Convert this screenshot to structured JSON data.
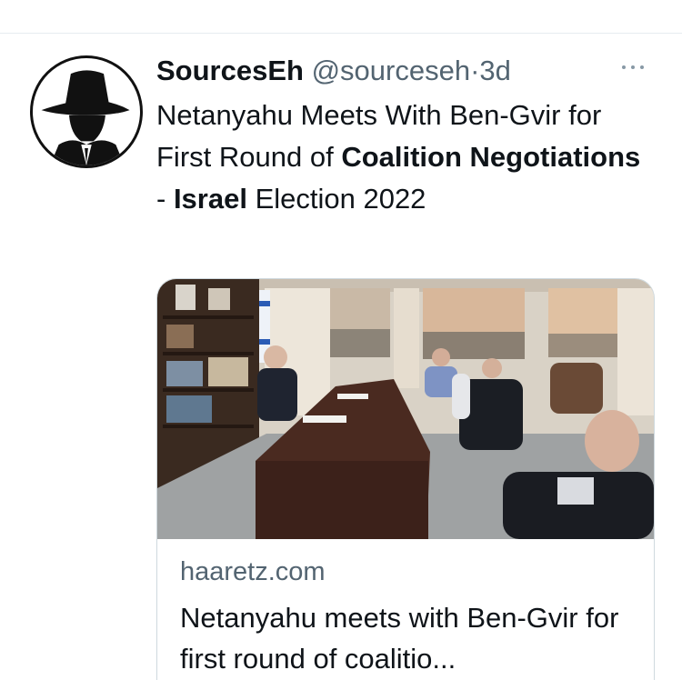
{
  "tweet": {
    "author_name": "SourcesEh",
    "author_handle": "@sourceseh",
    "separator": "·",
    "time": "3d",
    "text_parts": {
      "p1": "Netanyahu Meets With Ben-Gvir for First Round of ",
      "b1": "Coalition Negotiations",
      "p2": " - ",
      "b2": "Israel",
      "p3": " Election 2022"
    }
  },
  "card": {
    "domain": "haaretz.com",
    "title": "Netanyahu meets with Ben-Gvir for first round of coalitio..."
  },
  "icons": {
    "more": "more-horizontal-icon",
    "avatar": "spy-silhouette-avatar"
  },
  "colors": {
    "text_primary": "#0f1419",
    "text_secondary": "#536471",
    "border": "#cfd9de"
  }
}
